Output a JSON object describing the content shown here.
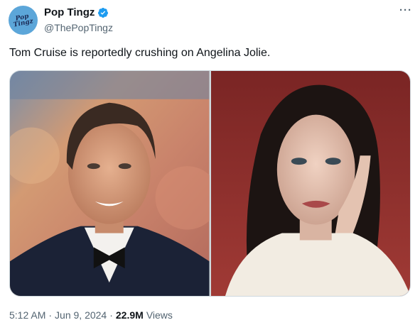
{
  "account": {
    "display_name": "Pop Tingz",
    "handle": "@ThePopTingz",
    "avatar_text": "Pop\nTingz",
    "verified_color": "#1d9bf0"
  },
  "more_label": "···",
  "tweet": {
    "text": "Tom Cruise is reportedly crushing on Angelina Jolie."
  },
  "media": {
    "photos": [
      {
        "subject": "man-in-tuxedo-photo"
      },
      {
        "subject": "woman-portrait-photo"
      }
    ]
  },
  "meta": {
    "time": "5:12 AM",
    "sep1": "·",
    "date": "Jun 9, 2024",
    "sep2": "·",
    "views_count": "22.9M",
    "views_label": "Views"
  }
}
